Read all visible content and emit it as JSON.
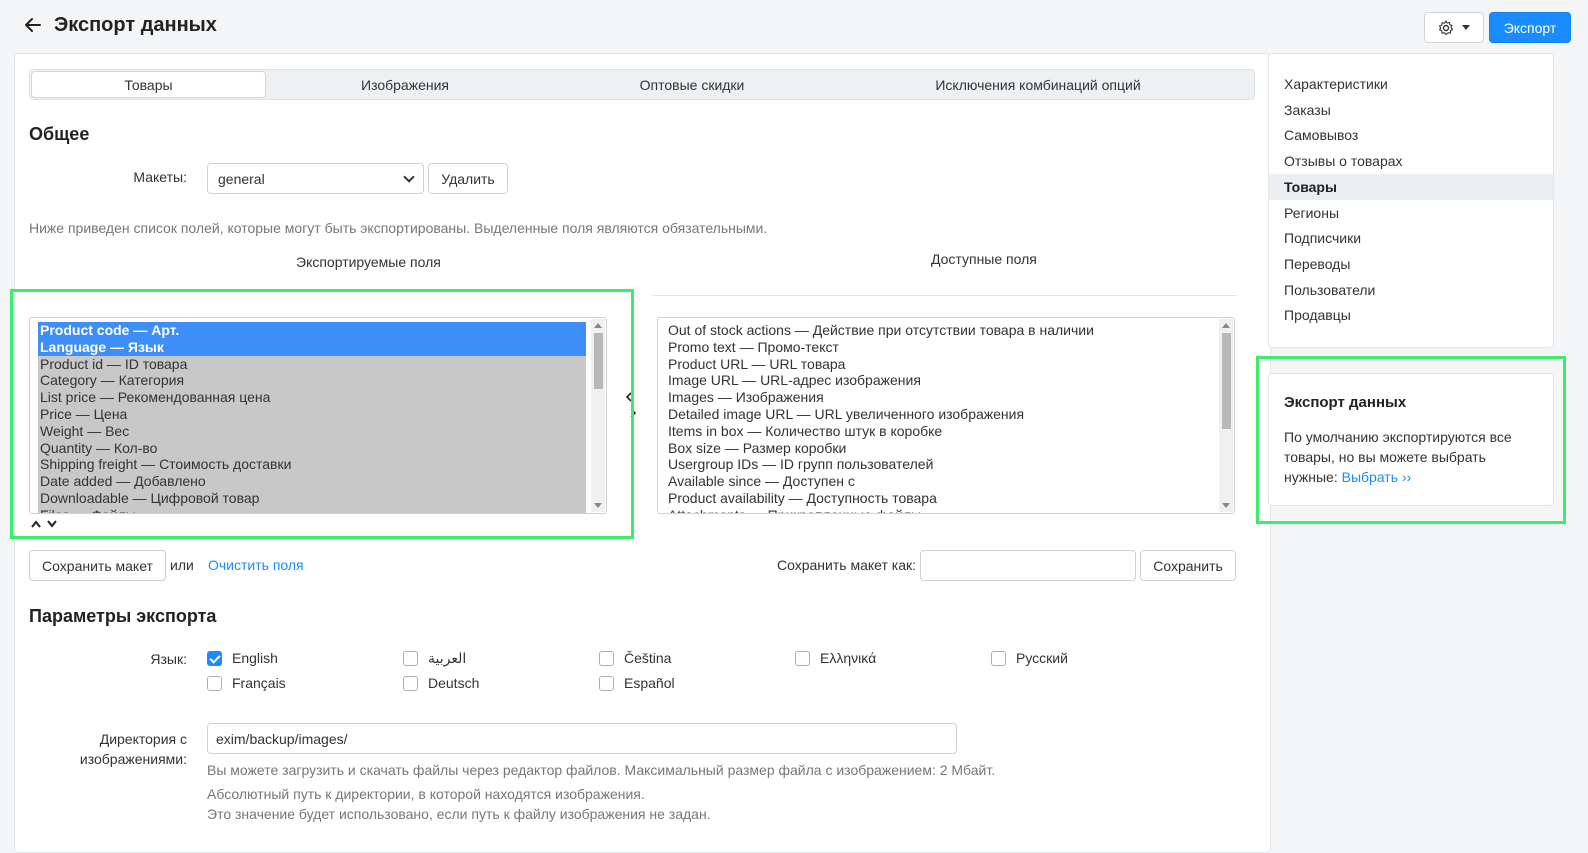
{
  "header": {
    "title": "Экспорт данных",
    "export_label": "Экспорт"
  },
  "tabs": [
    "Товары",
    "Изображения",
    "Оптовые скидки",
    "Исключения комбинаций опций"
  ],
  "general": {
    "title": "Общее",
    "layouts_label": "Макеты:",
    "layout_value": "general",
    "delete_label": "Удалить",
    "hint": "Ниже приведен список полей, которые могут быть экспортированы. Выделенные поля являются обязательными.",
    "exported_title": "Экспортируемые поля",
    "available_title": "Доступные поля"
  },
  "exported_fields": [
    {
      "text": "Product code — Арт.",
      "selected": true
    },
    {
      "text": "Language — Язык",
      "selected": true
    },
    {
      "text": "Product id — ID товара",
      "selected": false
    },
    {
      "text": "Category — Категория",
      "selected": false
    },
    {
      "text": "List price — Рекомендованная цена",
      "selected": false
    },
    {
      "text": "Price — Цена",
      "selected": false
    },
    {
      "text": "Weight — Вес",
      "selected": false
    },
    {
      "text": "Quantity — Кол-во",
      "selected": false
    },
    {
      "text": "Shipping freight — Стоимость доставки",
      "selected": false
    },
    {
      "text": "Date added — Добавлено",
      "selected": false
    },
    {
      "text": "Downloadable — Цифровой товар",
      "selected": false
    },
    {
      "text": "Files — Файлы",
      "selected": false
    }
  ],
  "available_fields": [
    "Out of stock actions — Действие при отсутствии товара в наличии",
    "Promo text — Промо-текст",
    "Product URL — URL товара",
    "Image URL — URL-адрес изображения",
    "Images — Изображения",
    "Detailed image URL — URL увеличенного изображения",
    "Items in box — Количество штук в коробке",
    "Box size — Размер коробки",
    "Usergroup IDs — ID групп пользователей",
    "Available since — Доступен с",
    "Product availability — Доступность товара",
    "Attachments — Прикрепленные файлы"
  ],
  "layout_actions": {
    "save_layout_label": "Сохранить макет",
    "or_label": "или",
    "clear_fields_label": "Очистить поля",
    "save_as_label": "Сохранить макет как:",
    "save_as_value": "",
    "save_label": "Сохранить"
  },
  "export_params": {
    "title": "Параметры экспорта",
    "language_label": "Язык:",
    "languages": [
      {
        "name": "English",
        "checked": true
      },
      {
        "name": "العربية",
        "checked": false
      },
      {
        "name": "Čeština",
        "checked": false
      },
      {
        "name": "Ελληνικά",
        "checked": false
      },
      {
        "name": "Русский",
        "checked": false
      },
      {
        "name": "Français",
        "checked": false
      },
      {
        "name": "Deutsch",
        "checked": false
      },
      {
        "name": "Español",
        "checked": false
      }
    ],
    "images_dir_label_1": "Директория с",
    "images_dir_label_2": "изображениями:",
    "images_dir_value": "exim/backup/images/",
    "images_dir_hint_1": "Вы можете загрузить и скачать файлы через редактор файлов. Максимальный размер файла с изображением: 2 Мбайт.",
    "images_dir_hint_2": "Абсолютный путь к директории, в которой находятся изображения.",
    "images_dir_hint_3": "Это значение будет использовано, если путь к файлу изображения не задан."
  },
  "sidebar": {
    "items": [
      "Характеристики",
      "Заказы",
      "Самовывоз",
      "Отзывы о товарах",
      "Товары",
      "Регионы",
      "Подписчики",
      "Переводы",
      "Пользователи",
      "Продавцы"
    ],
    "active_index": 4
  },
  "info_card": {
    "title": "Экспорт данных",
    "text": "По умолчанию экспортируются все товары, но вы можете выбрать нужные:",
    "link": "Выбрать ››"
  },
  "colors": {
    "accent": "#1a8cff",
    "highlight": "#3cec6b",
    "selected_row": "#3e8ef7",
    "unselected_row": "#c8c8c8"
  }
}
